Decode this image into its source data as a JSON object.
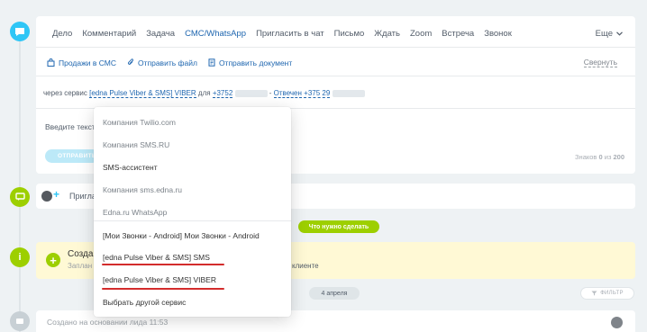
{
  "tabs": [
    {
      "label": "Дело"
    },
    {
      "label": "Комментарий"
    },
    {
      "label": "Задача"
    },
    {
      "label": "СМС/WhatsApp",
      "active": true
    },
    {
      "label": "Пригласить в чат"
    },
    {
      "label": "Письмо"
    },
    {
      "label": "Ждать"
    },
    {
      "label": "Zoom"
    },
    {
      "label": "Встреча"
    },
    {
      "label": "Звонок"
    }
  ],
  "tabs_more": "Еще",
  "actions": {
    "sales_sms": "Продажи в СМС",
    "send_file": "Отправить файл",
    "send_document": "Отправить документ",
    "collapse": "Свернуть"
  },
  "service_row": {
    "prefix": "через сервис",
    "service": "[edna Pulse Viber & SMS] VIBER",
    "for_label": "для",
    "phone_1": "+3752",
    "replied": "Отвечен",
    "phone_2": "+375 29"
  },
  "editor": {
    "placeholder": "Введите текст",
    "send_button": "ОТПРАВИТЬ",
    "chars_label": "Знаков",
    "chars_count": "0",
    "chars_of": "из",
    "chars_max": "200"
  },
  "invite": {
    "text": "Пригласить"
  },
  "todo_badge": "Что нужно сделать",
  "task": {
    "title": "Созда",
    "subtitle": "Заплан",
    "tail": "клиенте"
  },
  "date_badge": "4 апреля",
  "filter_label": "ФИЛЬТР",
  "history": {
    "text": "Создано на основании лида  11:53"
  },
  "dropdown": {
    "items": [
      {
        "label": "Компания Twilio.com",
        "muted": true
      },
      {
        "label": "Компания SMS.RU",
        "muted": true
      },
      {
        "label": "SMS-ассистент",
        "muted": false
      },
      {
        "label": "Компания sms.edna.ru",
        "muted": true
      },
      {
        "label": "Edna.ru WhatsApp",
        "muted": true
      },
      {
        "label": "[Мои Звонки - Android] Мои Звонки - Android",
        "muted": false
      },
      {
        "label": "[edna Pulse Viber & SMS] SMS",
        "muted": false,
        "underlined": true
      },
      {
        "label": "[edna Pulse Viber & SMS] VIBER",
        "muted": false,
        "underlined": true
      },
      {
        "label": "Выбрать другой сервис",
        "muted": false
      }
    ]
  },
  "colors": {
    "accent_blue": "#2fc6f6",
    "link_blue": "#2067b0",
    "green": "#9dcf00",
    "highlight_red": "#d32c2c",
    "task_bg": "#fff9d5"
  }
}
